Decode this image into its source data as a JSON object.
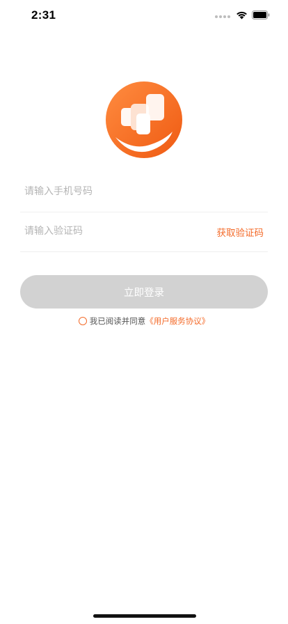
{
  "status_bar": {
    "time": "2:31"
  },
  "logo": {
    "icon": "app-logo",
    "colors": {
      "orange_light": "#ff8a3d",
      "orange_dark": "#f05a14"
    }
  },
  "form": {
    "phone_placeholder": "请输入手机号码",
    "code_placeholder": "请输入验证码",
    "get_code_label": "获取验证码",
    "login_label": "立即登录"
  },
  "agreement": {
    "prefix": "我已阅读并同意",
    "link_label": "《用户服务协议》",
    "checked": false
  },
  "colors": {
    "accent": "#f46b2a",
    "button_disabled": "#d2d2d2"
  }
}
